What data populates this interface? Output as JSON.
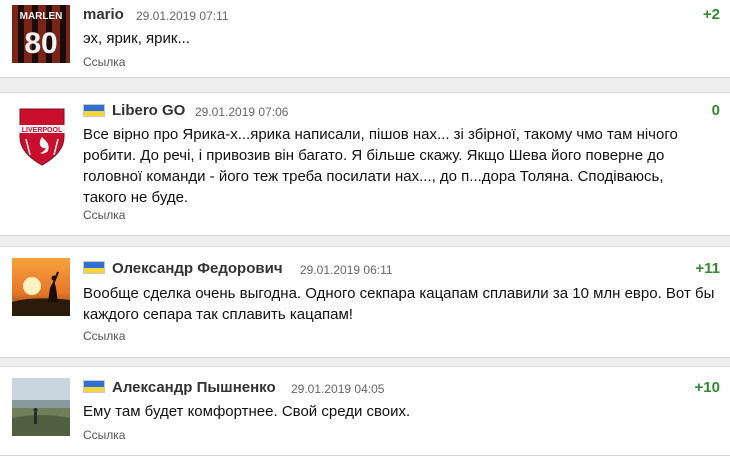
{
  "comments": [
    {
      "author": "mario",
      "date": "29.01.2019 07:11",
      "score": "+2",
      "text": "эх, ярик, ярик...",
      "link_label": "Ссылка",
      "avatar": {
        "type": "jersey",
        "jersey_name": "MARLEN",
        "jersey_number": "80"
      },
      "has_flag": false
    },
    {
      "author": "Libero GO",
      "date": "29.01.2019 07:06",
      "score": "0",
      "text": "Все вірно про Ярика-х...ярика написали, пішов нах... зі збірної, такому чмо там нічого\nробити. До речі, і привозив він багато. Я більше скажу. Якщо Шева його поверне до\nголовної команди - його теж треба посилати нах..., до п...дора Толяна. Сподіваюсь,\nтакого не буде.",
      "link_label": "Ссылка",
      "avatar": {
        "type": "crest",
        "crest_text": "LIVERPOOL"
      },
      "has_flag": true
    },
    {
      "author": "Олександр Федорович",
      "date": "29.01.2019 06:11",
      "score": "+11",
      "text": "Вообще сделка очень выгодна. Одного секпара кацапам сплавили за 10 млн евро. Вот бы\nкаждого сепара так сплавить кацапам!",
      "link_label": "Ссылка",
      "avatar": {
        "type": "sunset"
      },
      "has_flag": true
    },
    {
      "author": "Александр Пышненко",
      "date": "29.01.2019 04:05",
      "score": "+10",
      "text": "Ему там будет комфортнее. Свой среди своих.",
      "link_label": "Ссылка",
      "avatar": {
        "type": "landscape"
      },
      "has_flag": true
    }
  ],
  "colors": {
    "score_green": "#2e8b2e",
    "flag_blue": "#2f6fd6",
    "flag_yellow": "#f3d43a"
  }
}
